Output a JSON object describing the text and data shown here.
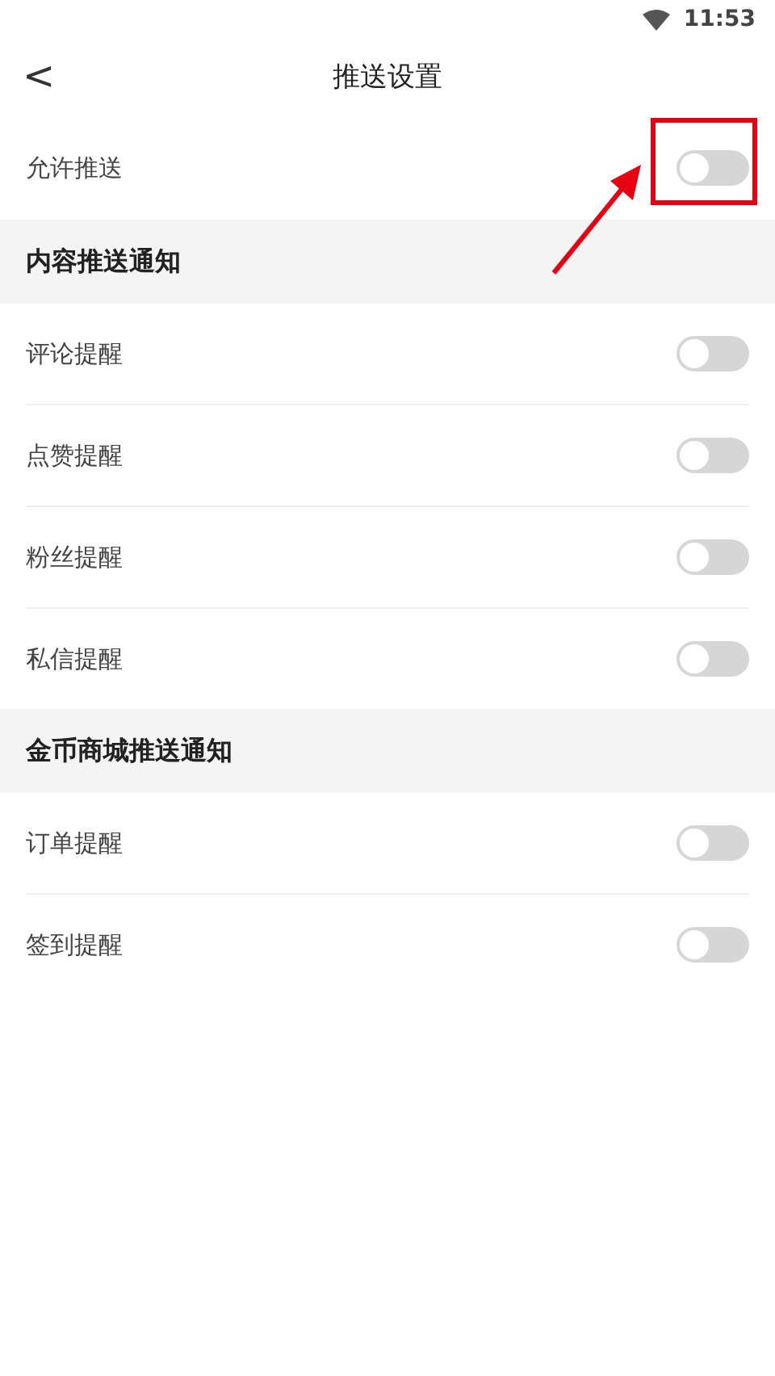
{
  "status_bar": {
    "time": "11:53"
  },
  "header": {
    "back": "<",
    "title": "推送设置"
  },
  "master": {
    "label": "允许推送",
    "on": false,
    "highlighted": true
  },
  "sections": [
    {
      "title": "内容推送通知",
      "items": [
        {
          "label": "评论提醒",
          "on": false
        },
        {
          "label": "点赞提醒",
          "on": false
        },
        {
          "label": "粉丝提醒",
          "on": false
        },
        {
          "label": "私信提醒",
          "on": false
        }
      ]
    },
    {
      "title": "金币商城推送通知",
      "items": [
        {
          "label": "订单提醒",
          "on": false
        },
        {
          "label": "签到提醒",
          "on": false
        }
      ]
    }
  ]
}
